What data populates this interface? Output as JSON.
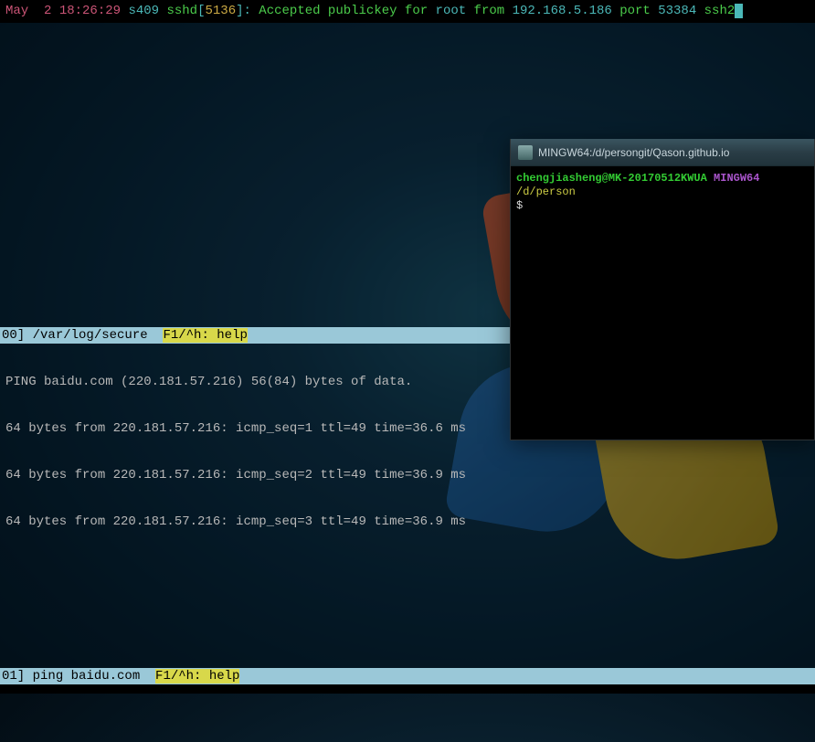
{
  "ssh_log": {
    "date": "May  2",
    "time": "18:26:29",
    "host": "s409",
    "proc": "sshd",
    "pid_open": "[",
    "pid": "5136",
    "pid_close": "]",
    "colon": ":",
    "msg1": " Accepted publickey for ",
    "user": "root",
    "msg2": " from ",
    "ip": "192.168.5.186",
    "msg3": " port ",
    "port": "53384",
    "msg4": " ssh2"
  },
  "pane0": {
    "prefix": "00] ",
    "path": "/var/log/secure",
    "gap": "  ",
    "help": "F1/^h: help"
  },
  "ping": {
    "header": "PING baidu.com (220.181.57.216) 56(84) bytes of data.",
    "lines": [
      "64 bytes from 220.181.57.216: icmp_seq=1 ttl=49 time=36.6 ms",
      "64 bytes from 220.181.57.216: icmp_seq=2 ttl=49 time=36.9 ms",
      "64 bytes from 220.181.57.216: icmp_seq=3 ttl=49 time=36.9 ms"
    ]
  },
  "pane1": {
    "prefix": "01] ",
    "cmd": "ping baidu.com",
    "gap": "  ",
    "help": "F1/^h: help"
  },
  "mingw": {
    "title": "MINGW64:/d/persongit/Qason.github.io",
    "user_host": "chengjiasheng@MK-20170512KWUA",
    "env": "MINGW64",
    "cwd": " /d/person",
    "prompt": "$ "
  }
}
